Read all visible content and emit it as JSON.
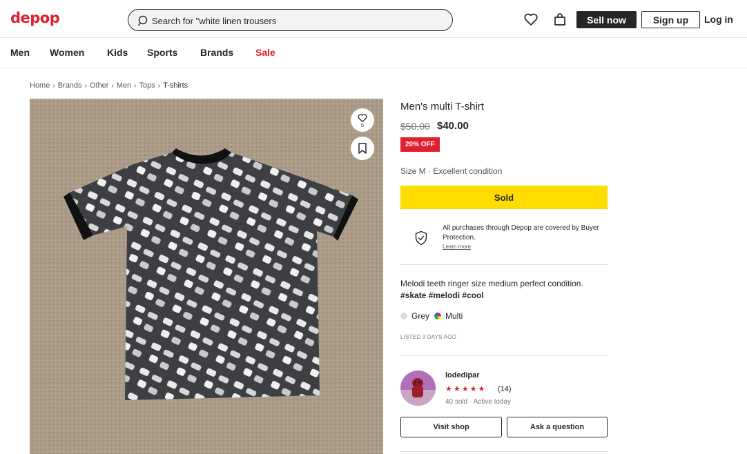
{
  "header": {
    "logo": "depop",
    "search_value": "Search for \"white linen trousers",
    "sell_label": "Sell now",
    "signup_label": "Sign up",
    "login_label": "Log in"
  },
  "nav": {
    "items": [
      "Men",
      "Women",
      "Kids",
      "Sports",
      "Brands",
      "Sale"
    ]
  },
  "breadcrumb": [
    "Home",
    "Brands",
    "Other",
    "Men",
    "Tops",
    "T-shirts"
  ],
  "product": {
    "like_count": "5",
    "title": "Men's multi T-shirt",
    "price_original": "$50.00",
    "price_current": "$40.00",
    "discount_badge": "20% OFF",
    "size_condition": "Size M · Excellent condition",
    "sold_label": "Sold",
    "protection_text": "All purchases through Depop are covered by Buyer Protection.",
    "protection_link": "Learn more",
    "description_text": "Melodi teeth ringer size medium perfect condition. ",
    "hashtags": [
      "#skate",
      "#melodi",
      "#cool"
    ],
    "colors": [
      {
        "name": "Grey",
        "hex": "#dcdcdc"
      },
      {
        "name": "Multi",
        "hex": "multicolor"
      }
    ],
    "listed": "LISTED 3 DAYS AGO"
  },
  "seller": {
    "username": "lodedipar",
    "stars": "★★★★★",
    "rating": 5,
    "review_count": "(14)",
    "stats": "40 sold · Active today",
    "visit_label": "Visit shop",
    "ask_label": "Ask a question"
  },
  "colors": {
    "brand": "#e0202e",
    "sold": "#ffdc00",
    "dark": "#262626"
  }
}
